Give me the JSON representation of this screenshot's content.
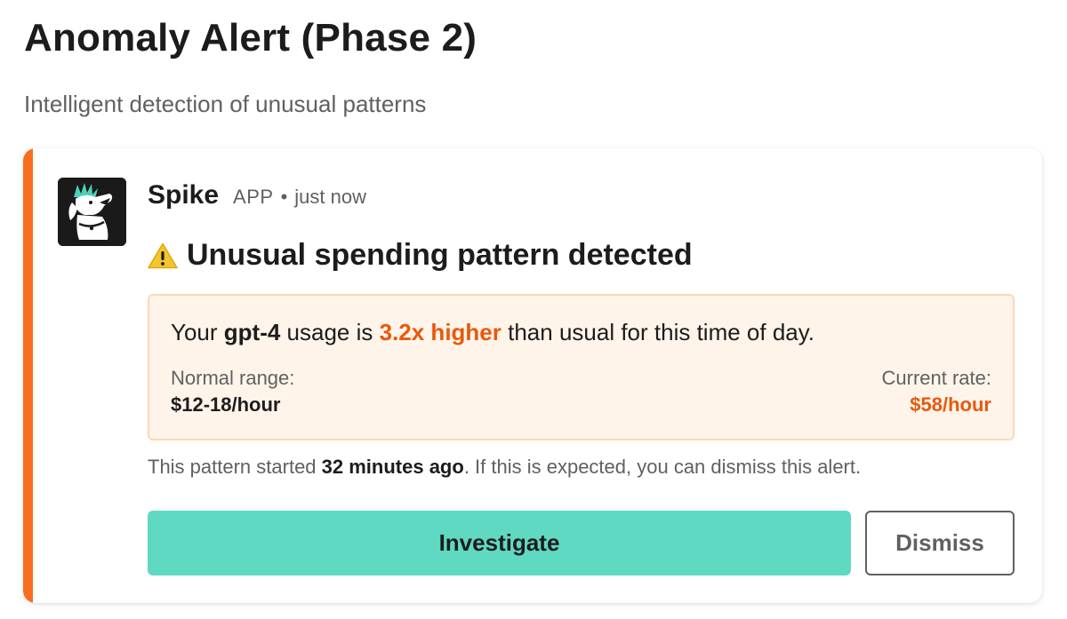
{
  "page": {
    "title": "Anomaly Alert (Phase 2)",
    "subtitle": "Intelligent detection of unusual patterns"
  },
  "message": {
    "sender": "Spike",
    "badge": "APP",
    "separator": "•",
    "timestamp": "just now",
    "avatar_icon": "dog-mascot-icon",
    "alert_icon": "warning-triangle-icon",
    "alert_title": "Unusual spending pattern detected",
    "summary": {
      "prefix": "Your ",
      "model": "gpt-4",
      "middle": " usage is ",
      "multiplier": "3.2x higher",
      "suffix": " than usual for this time of day."
    },
    "normal_range": {
      "label": "Normal range:",
      "value": "$12-18/hour"
    },
    "current_rate": {
      "label": "Current rate:",
      "value": "$58/hour"
    },
    "footnote": {
      "prefix": "This pattern started ",
      "duration": "32 minutes ago",
      "suffix": ". If this is expected, you can dismiss this alert."
    },
    "actions": {
      "investigate_label": "Investigate",
      "dismiss_label": "Dismiss"
    }
  },
  "colors": {
    "accent_bar": "#fb6d1e",
    "highlight": "#e8590c",
    "info_bg": "#fff4ea",
    "info_border": "#fbd9b4",
    "primary_button": "#5fd9c2"
  }
}
